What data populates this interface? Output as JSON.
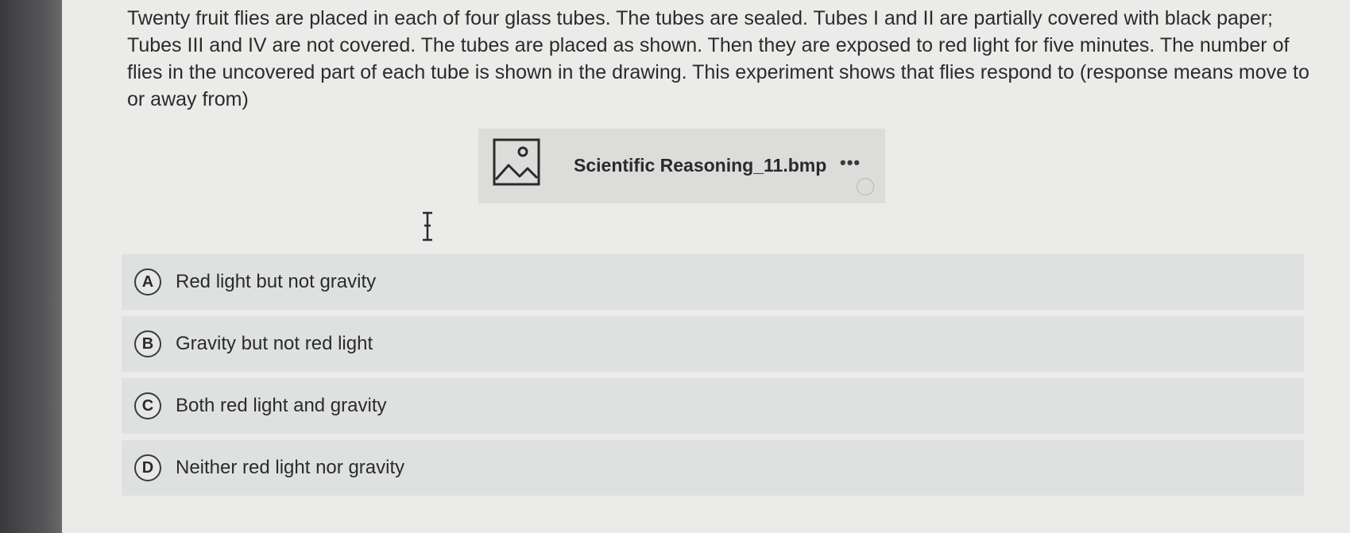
{
  "question": {
    "text": "Twenty fruit flies are placed in each of four glass tubes. The tubes are sealed. Tubes I and II are partially covered with black paper; Tubes III and IV are not covered. The tubes are placed as shown. Then they are exposed to red light for five minutes. The number of flies in the uncovered part of each tube is shown in the drawing. This experiment shows that flies respond to (response means move to or away from)"
  },
  "attachment": {
    "file_name": "Scientific Reasoning_11.bmp",
    "more_label": "•••",
    "icon": "image-icon"
  },
  "choices": [
    {
      "letter": "A",
      "text": "Red light but not gravity"
    },
    {
      "letter": "B",
      "text": "Gravity but not red light"
    },
    {
      "letter": "C",
      "text": "Both red light and gravity"
    },
    {
      "letter": "D",
      "text": "Neither red light nor gravity"
    }
  ],
  "colors": {
    "page_background": "#ebebea",
    "choice_background": "#dfe1e1",
    "attachment_background": "#dcdcdb",
    "text": "#2b2b2b"
  }
}
